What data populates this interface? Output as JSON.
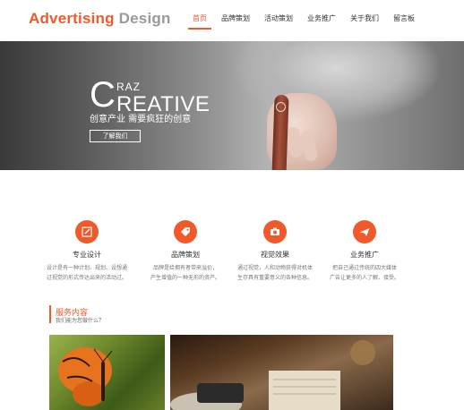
{
  "header": {
    "logo_part1": "Advertising",
    "logo_part2": "Design",
    "nav": [
      {
        "label": "首页",
        "active": true
      },
      {
        "label": "品牌策划",
        "active": false
      },
      {
        "label": "活动策划",
        "active": false
      },
      {
        "label": "业务推广",
        "active": false
      },
      {
        "label": "关于我们",
        "active": false
      },
      {
        "label": "留言板",
        "active": false
      }
    ]
  },
  "banner": {
    "craz_c": "C",
    "craz_rest": "RAZ",
    "creative": "REATIVE",
    "subtitle": "创意产业   需要疯狂的创意",
    "button": "了解我们"
  },
  "features": [
    {
      "icon": "edit-icon",
      "title": "专业设计",
      "desc": [
        "设计是有一种计划、规划、设想通",
        "过视觉的形式传达出来的活动过。"
      ]
    },
    {
      "icon": "tag-icon",
      "title": "品牌策划",
      "desc": [
        "品牌是给拥有者带来溢价，",
        "产生增值的一种无形的资产。"
      ]
    },
    {
      "icon": "camera-icon",
      "title": "视觉效果",
      "desc": [
        "通过视觉，人和动物获得对机体",
        "生存具有重要意义的各种信息。"
      ]
    },
    {
      "icon": "plane-icon",
      "title": "业务推广",
      "desc": [
        "把自己通过传统的四大媒体",
        "广告让更多的人了解、接受。"
      ]
    }
  ],
  "services": {
    "title": "服务内容",
    "subtitle": "我们能为您做什么？"
  },
  "colors": {
    "accent": "#f05a2b",
    "logo_gray": "#999999"
  }
}
